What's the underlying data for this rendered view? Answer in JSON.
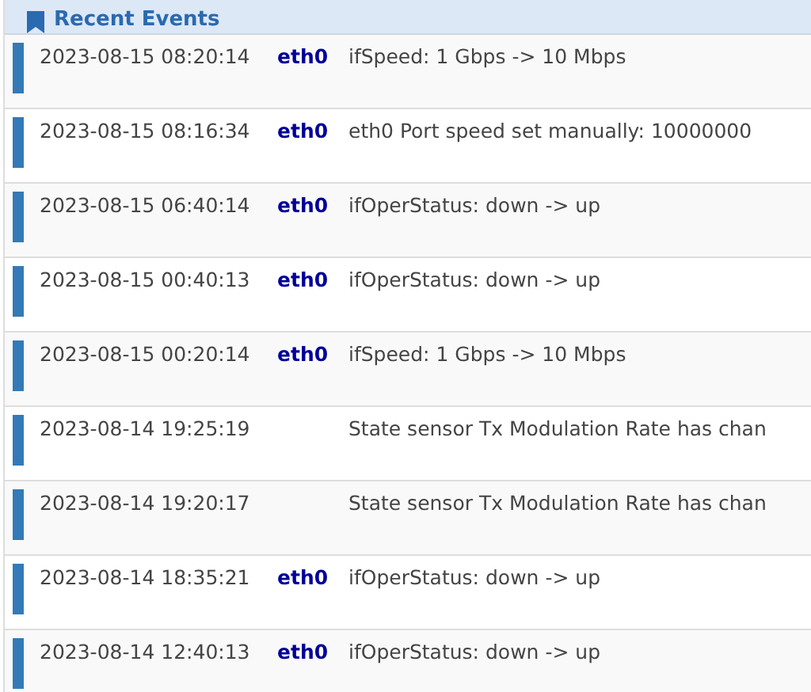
{
  "panel": {
    "title": "Recent Events"
  },
  "events": [
    {
      "time": "2023-08-15 08:20:14",
      "device": "eth0",
      "message": "ifSpeed: 1 Gbps -> 10 Mbps"
    },
    {
      "time": "2023-08-15 08:16:34",
      "device": "eth0",
      "message": "eth0 Port speed set manually: 10000000"
    },
    {
      "time": "2023-08-15 06:40:14",
      "device": "eth0",
      "message": "ifOperStatus: down -> up"
    },
    {
      "time": "2023-08-15 00:40:13",
      "device": "eth0",
      "message": "ifOperStatus: down -> up"
    },
    {
      "time": "2023-08-15 00:20:14",
      "device": "eth0",
      "message": "ifSpeed: 1 Gbps -> 10 Mbps"
    },
    {
      "time": "2023-08-14 19:25:19",
      "message": "State sensor Tx Modulation Rate has chan"
    },
    {
      "time": "2023-08-14 19:20:17",
      "message": "State sensor Tx Modulation Rate has chan"
    },
    {
      "time": "2023-08-14 18:35:21",
      "device": "eth0",
      "message": "ifOperStatus: down -> up"
    },
    {
      "time": "2023-08-14 12:40:13",
      "device": "eth0",
      "message": "ifOperStatus: down -> up"
    }
  ]
}
